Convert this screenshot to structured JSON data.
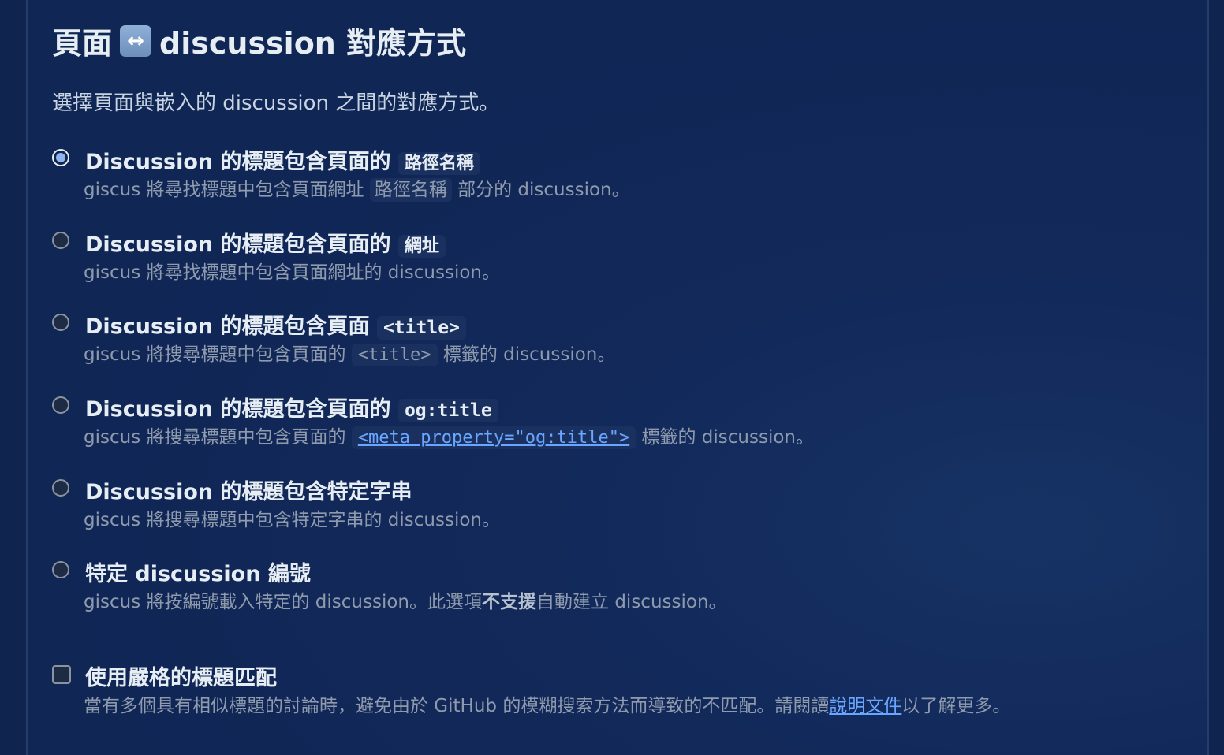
{
  "section": {
    "title_left": "頁面",
    "title_emoji": "↔",
    "title_right": "discussion 對應方式",
    "description": "選擇頁面與嵌入的 discussion 之間的對應方式。"
  },
  "options": [
    {
      "label_text": "Discussion 的標題包含頁面的",
      "label_chip": "路徑名稱",
      "desc_before": "giscus 將尋找標題中包含頁面網址",
      "desc_chip": "路徑名稱",
      "desc_after": "部分的 discussion。",
      "checked": true
    },
    {
      "label_text": "Discussion 的標題包含頁面的",
      "label_chip": "網址",
      "desc": "giscus 將尋找標題中包含頁面網址的 discussion。",
      "checked": false
    },
    {
      "label_text": "Discussion 的標題包含頁面",
      "label_code": "<title>",
      "desc_before": "giscus 將搜尋標題中包含頁面的",
      "desc_code": "<title>",
      "desc_after": "標籤的 discussion。",
      "checked": false
    },
    {
      "label_text": "Discussion 的標題包含頁面的",
      "label_code": "og:title",
      "desc_before": "giscus 將搜尋標題中包含頁面的",
      "desc_code": "<meta property=\"og:title\">",
      "desc_after": "標籤的 discussion。",
      "checked": false
    },
    {
      "label_text": "Discussion 的標題包含特定字串",
      "desc": "giscus 將搜尋標題中包含特定字串的 discussion。",
      "checked": false
    },
    {
      "label_text": "特定 discussion 編號",
      "desc_before": "giscus 將按編號載入特定的 discussion。此選項",
      "desc_strong": "不支援",
      "desc_after": "自動建立 discussion。",
      "checked": false
    }
  ],
  "strict": {
    "label": "使用嚴格的標題匹配",
    "desc_before": "當有多個具有相似標題的討論時，避免由於 GitHub 的模糊搜索方法而導致的不匹配。請閱讀",
    "desc_link": "說明文件",
    "desc_after": "以了解更多。",
    "checked": false
  }
}
